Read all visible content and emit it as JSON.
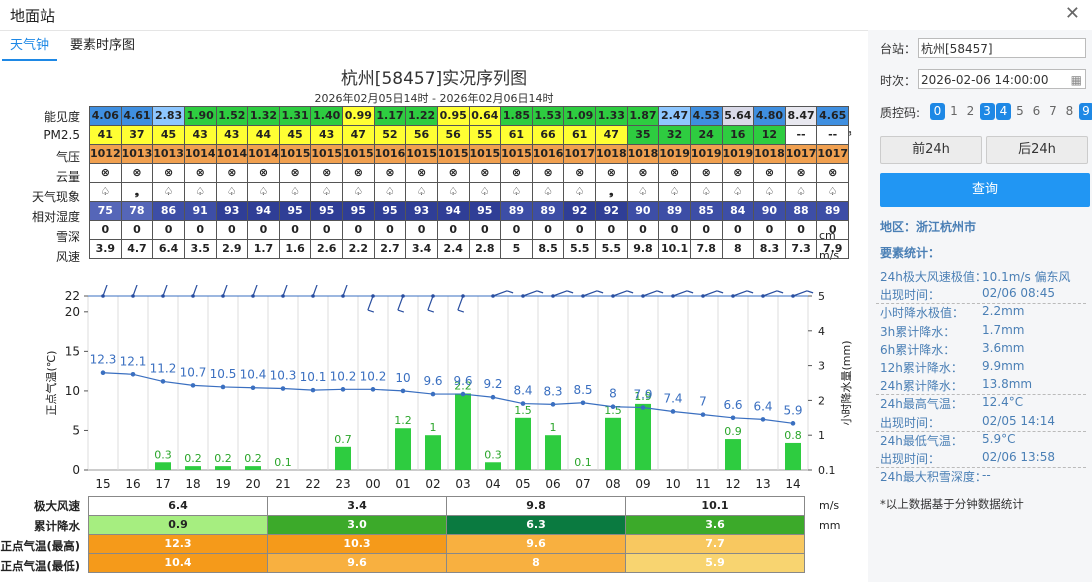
{
  "window": {
    "title": "地面站"
  },
  "tabs": [
    "天气钟",
    "要素时序图"
  ],
  "chart_title": "杭州[58457]实况序列图",
  "chart_subtitle": "2026年02月05日14时 - 2026年02月06日14时",
  "rows": [
    {
      "label": "能见度",
      "unit": "km",
      "values": [
        "4.06",
        "4.61",
        "2.83",
        "1.90",
        "1.52",
        "1.32",
        "1.31",
        "1.40",
        "0.99",
        "1.17",
        "1.22",
        "0.95",
        "0.64",
        "1.85",
        "1.53",
        "1.09",
        "1.33",
        "1.87",
        "2.47",
        "4.53",
        "5.64",
        "4.80",
        "8.47",
        "4.65"
      ],
      "colors": [
        "#3f8fe0",
        "#3f8fe0",
        "#8ec7ff",
        "#2ecc40",
        "#2ecc40",
        "#2ecc40",
        "#2ecc40",
        "#2ecc40",
        "#ffff33",
        "#2ecc40",
        "#2ecc40",
        "#ffff33",
        "#ffff33",
        "#2ecc40",
        "#2ecc40",
        "#2ecc40",
        "#2ecc40",
        "#2ecc40",
        "#8ec7ff",
        "#3f8fe0",
        "#d9d9e8",
        "#3f8fe0",
        "#e8e8f0",
        "#3f8fe0"
      ]
    },
    {
      "label": "PM2.5",
      "unit": "μg/m³",
      "values": [
        "41",
        "37",
        "45",
        "43",
        "43",
        "44",
        "45",
        "43",
        "47",
        "52",
        "56",
        "56",
        "55",
        "61",
        "66",
        "61",
        "47",
        "35",
        "32",
        "24",
        "16",
        "12",
        "--",
        "--"
      ],
      "colors": [
        "#ffff33",
        "#ffff33",
        "#ffff33",
        "#ffff33",
        "#ffff33",
        "#ffff33",
        "#ffff33",
        "#ffff33",
        "#ffff33",
        "#ffff33",
        "#ffff33",
        "#ffff33",
        "#ffff33",
        "#ffff33",
        "#ffff33",
        "#ffff33",
        "#ffff33",
        "#2ecc40",
        "#2ecc40",
        "#2ecc40",
        "#2ecc40",
        "#2ecc40",
        "#ffffff",
        "#ffffff"
      ]
    },
    {
      "label": "气压",
      "unit": "hPa",
      "values": [
        "1012",
        "1013",
        "1013",
        "1014",
        "1014",
        "1014",
        "1015",
        "1015",
        "1015",
        "1016",
        "1015",
        "1015",
        "1015",
        "1015",
        "1016",
        "1017",
        "1018",
        "1018",
        "1019",
        "1019",
        "1019",
        "1018",
        "1017",
        "1017"
      ],
      "colors": [
        "#f0a050",
        "#f0a050",
        "#f0a050",
        "#f0a050",
        "#f0a050",
        "#f0a050",
        "#f0a050",
        "#f0a050",
        "#f0a050",
        "#f0a050",
        "#f0a050",
        "#f0a050",
        "#f0a050",
        "#f0a050",
        "#f0a050",
        "#f0a050",
        "#f0a050",
        "#f0a050",
        "#f0a050",
        "#f0a050",
        "#f0a050",
        "#f0a050",
        "#f0a050",
        "#f0a050"
      ]
    },
    {
      "label": "云量",
      "unit": "",
      "values": [
        "⊗",
        "⊗",
        "⊗",
        "⊗",
        "⊗",
        "⊗",
        "⊗",
        "⊗",
        "⊗",
        "⊗",
        "⊗",
        "⊗",
        "⊗",
        "⊗",
        "⊗",
        "⊗",
        "⊗",
        "⊗",
        "⊗",
        "⊗",
        "⊗",
        "⊗",
        "⊗",
        "⊗"
      ],
      "colors": []
    },
    {
      "label": "天气现象",
      "unit": "",
      "values": [
        "♤",
        "❟",
        "♤",
        "♤",
        "♤",
        "♤",
        "♤",
        "♤",
        "♤",
        "♤",
        "♤",
        "♤",
        "♤",
        "♤",
        "♤",
        "♤",
        "❟",
        "♤",
        "♤",
        "♤",
        "♤",
        "♤",
        "♤",
        "♤"
      ],
      "colors": []
    },
    {
      "label": "相对湿度",
      "unit": "%",
      "values": [
        "75",
        "78",
        "86",
        "91",
        "93",
        "94",
        "95",
        "95",
        "95",
        "95",
        "93",
        "94",
        "95",
        "89",
        "89",
        "92",
        "92",
        "90",
        "89",
        "85",
        "84",
        "90",
        "88",
        "89"
      ],
      "colors": [
        "#5566b8",
        "#5566b8",
        "#3d4ea6",
        "#3d4ea6",
        "#2f3e96",
        "#2f3e96",
        "#2f3e96",
        "#2f3e96",
        "#2f3e96",
        "#2f3e96",
        "#2f3e96",
        "#2f3e96",
        "#2f3e96",
        "#3d4ea6",
        "#3d4ea6",
        "#2f3e96",
        "#2f3e96",
        "#3d4ea6",
        "#3d4ea6",
        "#3d4ea6",
        "#3d4ea6",
        "#3d4ea6",
        "#3d4ea6",
        "#3d4ea6"
      ]
    },
    {
      "label": "雪深",
      "unit": "cm",
      "values": [
        "0",
        "0",
        "0",
        "0",
        "0",
        "0",
        "0",
        "0",
        "0",
        "0",
        "0",
        "0",
        "0",
        "0",
        "0",
        "0",
        "0",
        "0",
        "0",
        "0",
        "0",
        "0",
        "0",
        "0"
      ],
      "colors": []
    },
    {
      "label": "风速",
      "unit": "m/s",
      "values": [
        "3.9",
        "4.7",
        "6.4",
        "3.5",
        "2.9",
        "1.7",
        "1.6",
        "2.6",
        "2.2",
        "2.7",
        "3.4",
        "2.4",
        "2.8",
        "5",
        "8.5",
        "5.5",
        "5.5",
        "9.8",
        "10.1",
        "7.8",
        "8",
        "8.3",
        "7.3",
        "7.9"
      ],
      "colors": []
    }
  ],
  "chart_data": {
    "type": "line",
    "x": [
      "15",
      "16",
      "17",
      "18",
      "19",
      "20",
      "21",
      "22",
      "23",
      "00",
      "01",
      "02",
      "03",
      "04",
      "05",
      "06",
      "07",
      "08",
      "09",
      "10",
      "11",
      "12",
      "13",
      "14"
    ],
    "series": [
      {
        "kind": "line",
        "color": "#3a6fc0",
        "values": [
          12.3,
          12.1,
          11.2,
          10.7,
          10.5,
          10.4,
          10.3,
          10.1,
          10.2,
          10.2,
          10,
          9.6,
          9.6,
          9.2,
          8.4,
          8.3,
          8.5,
          8,
          7.9,
          7.4,
          7,
          6.6,
          6.4,
          5.9
        ]
      },
      {
        "kind": "bar",
        "color": "#2ecc40",
        "values": [
          null,
          null,
          0.3,
          0.2,
          0.2,
          0.2,
          0.1,
          null,
          0.7,
          null,
          1.2,
          1,
          2.2,
          0.3,
          1.5,
          1,
          0.1,
          1.5,
          1.9,
          null,
          null,
          0.9,
          null,
          0.8
        ]
      }
    ],
    "wind_barbs": [
      22,
      22,
      22,
      22,
      22,
      22,
      22,
      22,
      22,
      22,
      22,
      22,
      22,
      22,
      22,
      22,
      22,
      22,
      22,
      22,
      22,
      22,
      22,
      22
    ],
    "ylabel_left": "正点气温(℃)",
    "ylabel_right": "小时降水量(mm)",
    "yleft_ticks": [
      "0",
      "5",
      "10",
      "15",
      "20",
      "22"
    ],
    "yright_ticks": [
      "0.1",
      "1",
      "2",
      "3",
      "4",
      "5"
    ],
    "ylim": [
      0,
      22
    ]
  },
  "summary": [
    {
      "label": "极大风速",
      "unit": "m/s",
      "cells": [
        {
          "v": "6.4",
          "c": "#ffffff"
        },
        {
          "v": "3.4",
          "c": "#ffffff"
        },
        {
          "v": "9.8",
          "c": "#ffffff"
        },
        {
          "v": "10.1",
          "c": "#ffffff"
        }
      ]
    },
    {
      "label": "累计降水",
      "unit": "mm",
      "cells": [
        {
          "v": "0.9",
          "c": "#a6ee80"
        },
        {
          "v": "3.0",
          "c": "#3caa2a"
        },
        {
          "v": "6.3",
          "c": "#0a7a40"
        },
        {
          "v": "3.6",
          "c": "#3caa2a"
        }
      ]
    },
    {
      "label": "正点气温(最高)",
      "unit": "",
      "cells": [
        {
          "v": "12.3",
          "c": "#f59a1a"
        },
        {
          "v": "10.3",
          "c": "#f59a1a"
        },
        {
          "v": "9.6",
          "c": "#f8b040"
        },
        {
          "v": "7.7",
          "c": "#f8c860"
        }
      ]
    },
    {
      "label": "正点气温(最低)",
      "unit": "",
      "cells": [
        {
          "v": "10.4",
          "c": "#f59a1a"
        },
        {
          "v": "9.6",
          "c": "#f8b040"
        },
        {
          "v": "8",
          "c": "#f8b040"
        },
        {
          "v": "5.9",
          "c": "#f8d470"
        }
      ]
    }
  ],
  "sidebar": {
    "station_label": "台站：",
    "station_value": "杭州[58457]",
    "time_label": "时次：",
    "time_value": "2026-02-06 14:00:00",
    "qc_label": "质控码:",
    "qc_codes": [
      {
        "v": "0",
        "on": true
      },
      {
        "v": "1",
        "on": false
      },
      {
        "v": "2",
        "on": false
      },
      {
        "v": "3",
        "on": true
      },
      {
        "v": "4",
        "on": true
      },
      {
        "v": "5",
        "on": false
      },
      {
        "v": "6",
        "on": false
      },
      {
        "v": "7",
        "on": false
      },
      {
        "v": "8",
        "on": false
      },
      {
        "v": "9",
        "on": true
      }
    ],
    "prev_button": "前24h",
    "next_button": "后24h",
    "query_button": "查询",
    "region": "地区：浙江杭州市",
    "stats_title": "要素统计：",
    "stats": [
      {
        "k": "24h极大风速极值：",
        "v": "10.1m/s 偏东风"
      },
      {
        "k": "出现时间：",
        "v": "02/06 08:45"
      },
      {
        "k": "小时降水极值：",
        "v": "2.2mm"
      },
      {
        "k": "3h累计降水：",
        "v": "1.7mm"
      },
      {
        "k": "6h累计降水：",
        "v": "3.6mm"
      },
      {
        "k": "12h累计降水：",
        "v": "9.9mm"
      },
      {
        "k": "24h累计降水：",
        "v": "13.8mm"
      },
      {
        "k": "24h最高气温：",
        "v": "12.4°C"
      },
      {
        "k": "出现时间：",
        "v": "02/05 14:14"
      },
      {
        "k": "24h最低气温：",
        "v": "5.9°C"
      },
      {
        "k": "出现时间：",
        "v": "02/06 13:58"
      },
      {
        "k": "24h最大积雪深度：",
        "v": "--"
      }
    ],
    "footnote": "*以上数据基于分钟数据统计"
  }
}
